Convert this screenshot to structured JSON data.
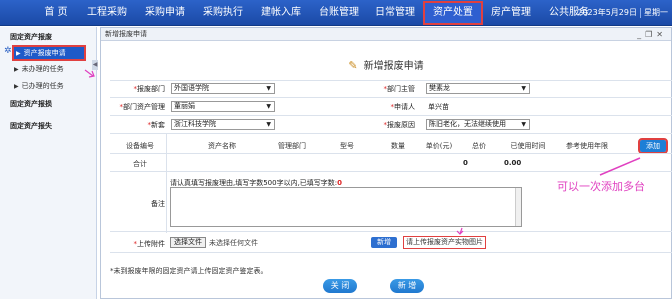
{
  "nav": {
    "items": [
      "首 页",
      "工程采购",
      "采购申请",
      "采购执行",
      "建帐入库",
      "台账管理",
      "日常管理",
      "资产处置",
      "房产管理",
      "公共服务"
    ],
    "active_index": 7,
    "date": "2023年5月29日",
    "weekday": "星期一"
  },
  "sidebar": {
    "group1": "固定资产报废",
    "items": [
      "资产报废申请",
      "未办理的任务",
      "已办理的任务"
    ],
    "group2": "固定资产报损",
    "group3": "固定资产报失"
  },
  "panel": {
    "tab": "新增报废申请",
    "heading": "新增报废申请"
  },
  "form": {
    "dept_label": "报废部门",
    "dept_value": "外国语学院",
    "dept_head_label": "部门主管",
    "dept_head_value": "樊素龙",
    "asset_admin_label": "部门资产管理",
    "asset_admin_value": "董丽娟",
    "applicant_label": "申请人",
    "applicant_value": "单兴苗",
    "new_label": "新套",
    "new_value": "浙江科技学院",
    "reason_label": "报废原因",
    "reason_value": "陈旧老化，无法继续使用"
  },
  "table": {
    "headers": [
      "设备编号",
      "资产名称",
      "管理部门",
      "型号",
      "数量",
      "单价(元)",
      "总价",
      "已使用时间",
      "参考使用年限"
    ],
    "total_label": "合计",
    "total_unit_price": "0",
    "total_sum": "0.00",
    "add_button": "添加"
  },
  "remark": {
    "label": "备注",
    "hint_prefix": "请认真填写报废理由,填写字数500字以内,已填写字数:",
    "hint_count": "0"
  },
  "attachment": {
    "label": "上传附件",
    "choose_button": "选择文件",
    "no_file": "未选择任何文件",
    "upload_button": "新增",
    "hint": "请上传报废资产实物图片"
  },
  "footnote": "*未到报废年限的固定资产请上传固定资产鉴定表。",
  "buttons": {
    "close": "关 闭",
    "add": "新 增"
  },
  "annotation": "可以一次添加多台",
  "colors": {
    "nav_bg": "#1b4aa6",
    "highlight": "#e04040",
    "annotation": "#e040c0"
  }
}
